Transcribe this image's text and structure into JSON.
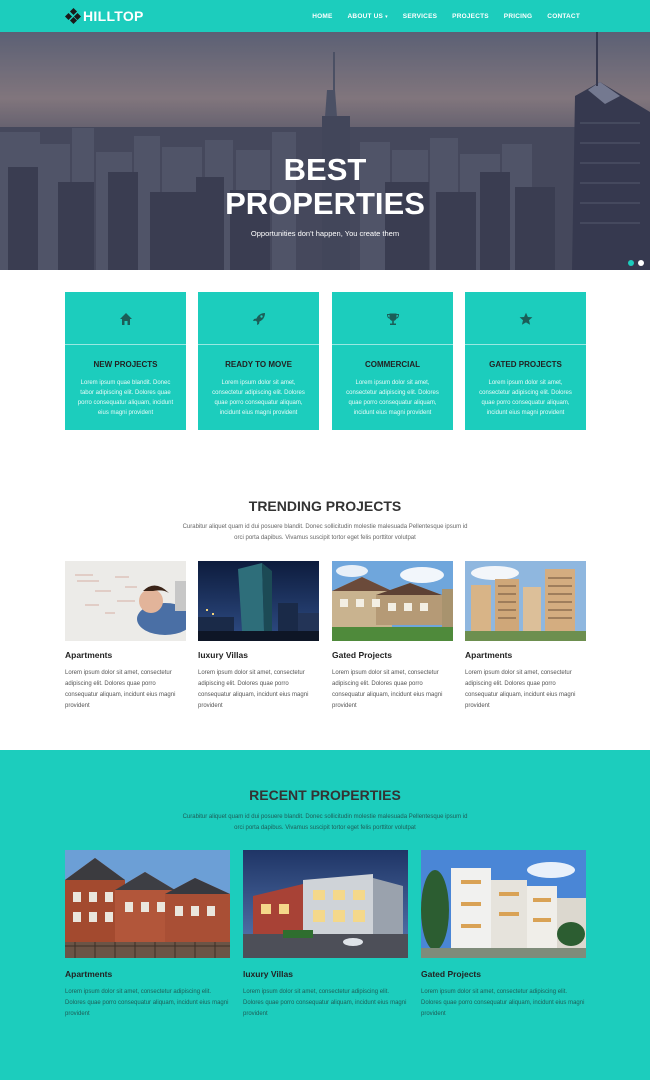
{
  "nav": {
    "logo": "HILLTOP",
    "items": [
      {
        "label": "HOME",
        "active": true
      },
      {
        "label": "ABOUT US",
        "dropdown": true
      },
      {
        "label": "SERVICES"
      },
      {
        "label": "PROJECTS"
      },
      {
        "label": "PRICING"
      },
      {
        "label": "CONTACT"
      }
    ],
    "dropdown_caret": "▾"
  },
  "hero": {
    "title_line1": "BEST",
    "title_line2": "PROPERTIES",
    "subtitle": "Opportunities don't happen, You create them",
    "active_slide": 1,
    "slide_count": 2
  },
  "features": [
    {
      "icon": "home-icon",
      "title": "NEW PROJECTS",
      "text": "Lorem ipsum quae blandit. Donec tabor adipiscing elit. Dolores quae porro consequatur aliquam, incidunt eius magni provident"
    },
    {
      "icon": "rocket-icon",
      "title": "READY TO MOVE",
      "text": "Lorem ipsum dolor sit amet, consectetur adipiscing elit. Dolores quae porro consequatur aliquam, incidunt eius magni provident"
    },
    {
      "icon": "trophy-icon",
      "title": "COMMERCIAL",
      "text": "Lorem ipsum dolor sit amet, consectetur adipiscing elit. Dolores quae porro consequatur aliquam, incidunt eius magni provident"
    },
    {
      "icon": "star-icon",
      "title": "GATED PROJECTS",
      "text": "Lorem ipsum dolor sit amet, consectetur adipiscing elit. Dolores quae porro consequatur aliquam, incidunt eius magni provident"
    }
  ],
  "trending": {
    "title": "TRENDING PROJECTS",
    "description": "Curabitur aliquet quam id dui posuere blandit. Donec sollicitudin molestie malesuada Pellentesque ipsum id orci porta dapibus. Vivamus suscipit tortor eget felis porttitor volutpat",
    "cards": [
      {
        "title": "Apartments",
        "text": "Lorem ipsum dolor sit amet, consectetur adipiscing elit. Dolores quae porro consequatur aliquam, incidunt eius magni provident"
      },
      {
        "title": "luxury Villas",
        "text": "Lorem ipsum dolor sit amet, consectetur adipiscing elit. Dolores quae porro consequatur aliquam, incidunt eius magni provident"
      },
      {
        "title": "Gated Projects",
        "text": "Lorem ipsum dolor sit amet, consectetur adipiscing elit. Dolores quae porro consequatur aliquam, incidunt eius magni provident"
      },
      {
        "title": "Apartments",
        "text": "Lorem ipsum dolor sit amet, consectetur adipiscing elit. Dolores quae porro consequatur aliquam, incidunt eius magni provident"
      }
    ]
  },
  "recent": {
    "title": "RECENT PROPERTIES",
    "description": "Curabitur aliquet quam id dui posuere blandit. Donec sollicitudin molestie malesuada Pellentesque ipsum id orci porta dapibus. Vivamus suscipit tortor eget felis porttitor volutpat",
    "cards": [
      {
        "title": "Apartments",
        "text": "Lorem ipsum dolor sit amet, consectetur adipiscing elit. Dolores quae porro consequatur aliquam, incidunt eius magni provident"
      },
      {
        "title": "luxury Villas",
        "text": "Lorem ipsum dolor sit amet, consectetur adipiscing elit. Dolores quae porro consequatur aliquam, incidunt eius magni provident"
      },
      {
        "title": "Gated Projects",
        "text": "Lorem ipsum dolor sit amet, consectetur adipiscing elit. Dolores quae porro consequatur aliquam, incidunt eius magni provident"
      }
    ]
  },
  "colors": {
    "accent": "#1ccdbd",
    "text_dark": "#222222",
    "text_muted": "#666666"
  }
}
